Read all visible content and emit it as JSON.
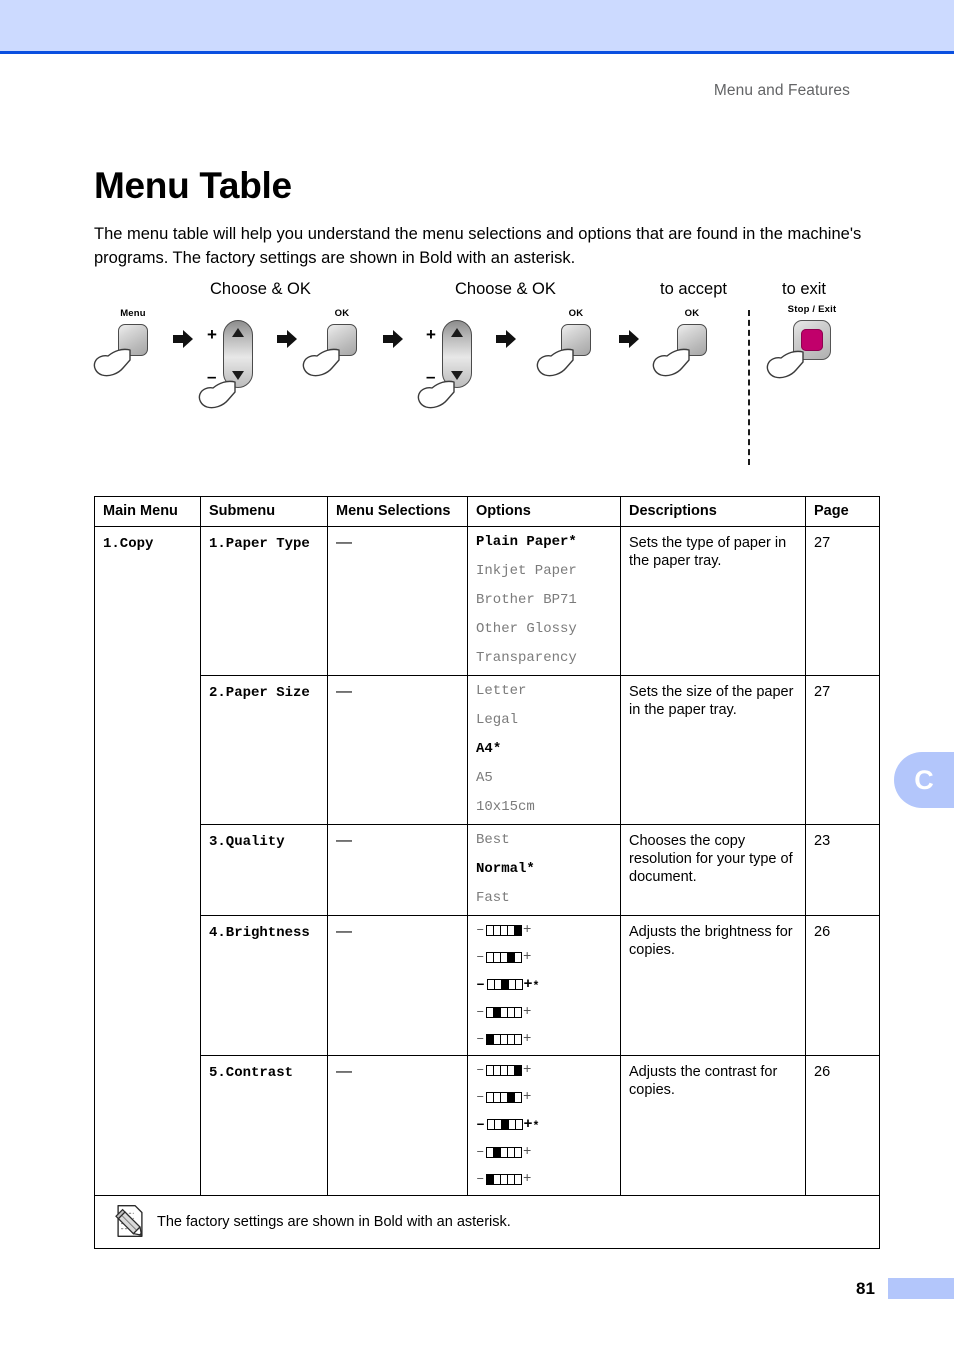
{
  "header": {
    "running_head": "Menu and Features"
  },
  "page": {
    "title": "Menu Table",
    "intro": "The menu table will help you understand the menu selections and options that are found in the machine's programs. The factory settings are shown in Bold with an asterisk.",
    "folio": "81",
    "side_tab": "C"
  },
  "diagram": {
    "labels": [
      {
        "text": "Choose & OK"
      },
      {
        "text": "Choose & OK"
      },
      {
        "text": "to accept"
      },
      {
        "text": "to exit"
      }
    ],
    "keys": [
      {
        "name": "menu-key",
        "caption": "Menu"
      },
      {
        "name": "nav-up-down-key",
        "caption": "",
        "plus": "+",
        "minus": "–"
      },
      {
        "name": "ok-key-1",
        "caption": "OK"
      },
      {
        "name": "nav-up-down-key-2",
        "caption": "",
        "plus": "+",
        "minus": "–"
      },
      {
        "name": "ok-key-2",
        "caption": "OK"
      },
      {
        "name": "ok-key-3",
        "caption": "OK"
      },
      {
        "name": "stop-exit-key",
        "caption": "Stop / Exit"
      }
    ]
  },
  "table": {
    "headers": [
      "Main Menu",
      "Submenu",
      "Menu Selections",
      "Options",
      "Descriptions",
      "Page"
    ],
    "main_menu": "1.Copy",
    "rows": [
      {
        "submenu": "1.Paper Type",
        "selections": "—",
        "options": [
          {
            "text": "Plain Paper",
            "default": true
          },
          {
            "text": "Inkjet Paper",
            "default": false
          },
          {
            "text": "Brother BP71",
            "default": false
          },
          {
            "text": "Other Glossy",
            "default": false
          },
          {
            "text": "Transparency",
            "default": false
          }
        ],
        "description": "Sets the type of paper in the paper tray.",
        "page": "27"
      },
      {
        "submenu": "2.Paper Size",
        "selections": "—",
        "options": [
          {
            "text": "Letter",
            "default": false
          },
          {
            "text": "Legal",
            "default": false
          },
          {
            "text": "A4",
            "default": true
          },
          {
            "text": "A5",
            "default": false
          },
          {
            "text": "10x15cm",
            "default": false
          }
        ],
        "description": "Sets the size of the paper in the paper tray.",
        "page": "27"
      },
      {
        "submenu": "3.Quality",
        "selections": "—",
        "options": [
          {
            "text": "Best",
            "default": false
          },
          {
            "text": "Normal",
            "default": true
          },
          {
            "text": "Fast",
            "default": false
          }
        ],
        "description": "Chooses the copy resolution for your type of document.",
        "page": "23"
      },
      {
        "submenu": "4.Brightness",
        "selections": "—",
        "sliders": [
          {
            "filled": 5,
            "total": 5,
            "default": false
          },
          {
            "filled": 4,
            "total": 5,
            "default": false
          },
          {
            "filled": 3,
            "total": 5,
            "default": true
          },
          {
            "filled": 2,
            "total": 5,
            "default": false
          },
          {
            "filled": 1,
            "total": 5,
            "default": false
          }
        ],
        "description": "Adjusts the brightness for copies.",
        "page": "26"
      },
      {
        "submenu": "5.Contrast",
        "selections": "—",
        "sliders": [
          {
            "filled": 5,
            "total": 5,
            "default": false
          },
          {
            "filled": 4,
            "total": 5,
            "default": false
          },
          {
            "filled": 3,
            "total": 5,
            "default": true
          },
          {
            "filled": 2,
            "total": 5,
            "default": false
          },
          {
            "filled": 1,
            "total": 5,
            "default": false
          }
        ],
        "description": "Adjusts the contrast for copies.",
        "page": "26"
      }
    ],
    "note": "The factory settings are shown in Bold with an asterisk.",
    "slider_minus": "–",
    "slider_plus": "+",
    "asterisk": "*"
  }
}
